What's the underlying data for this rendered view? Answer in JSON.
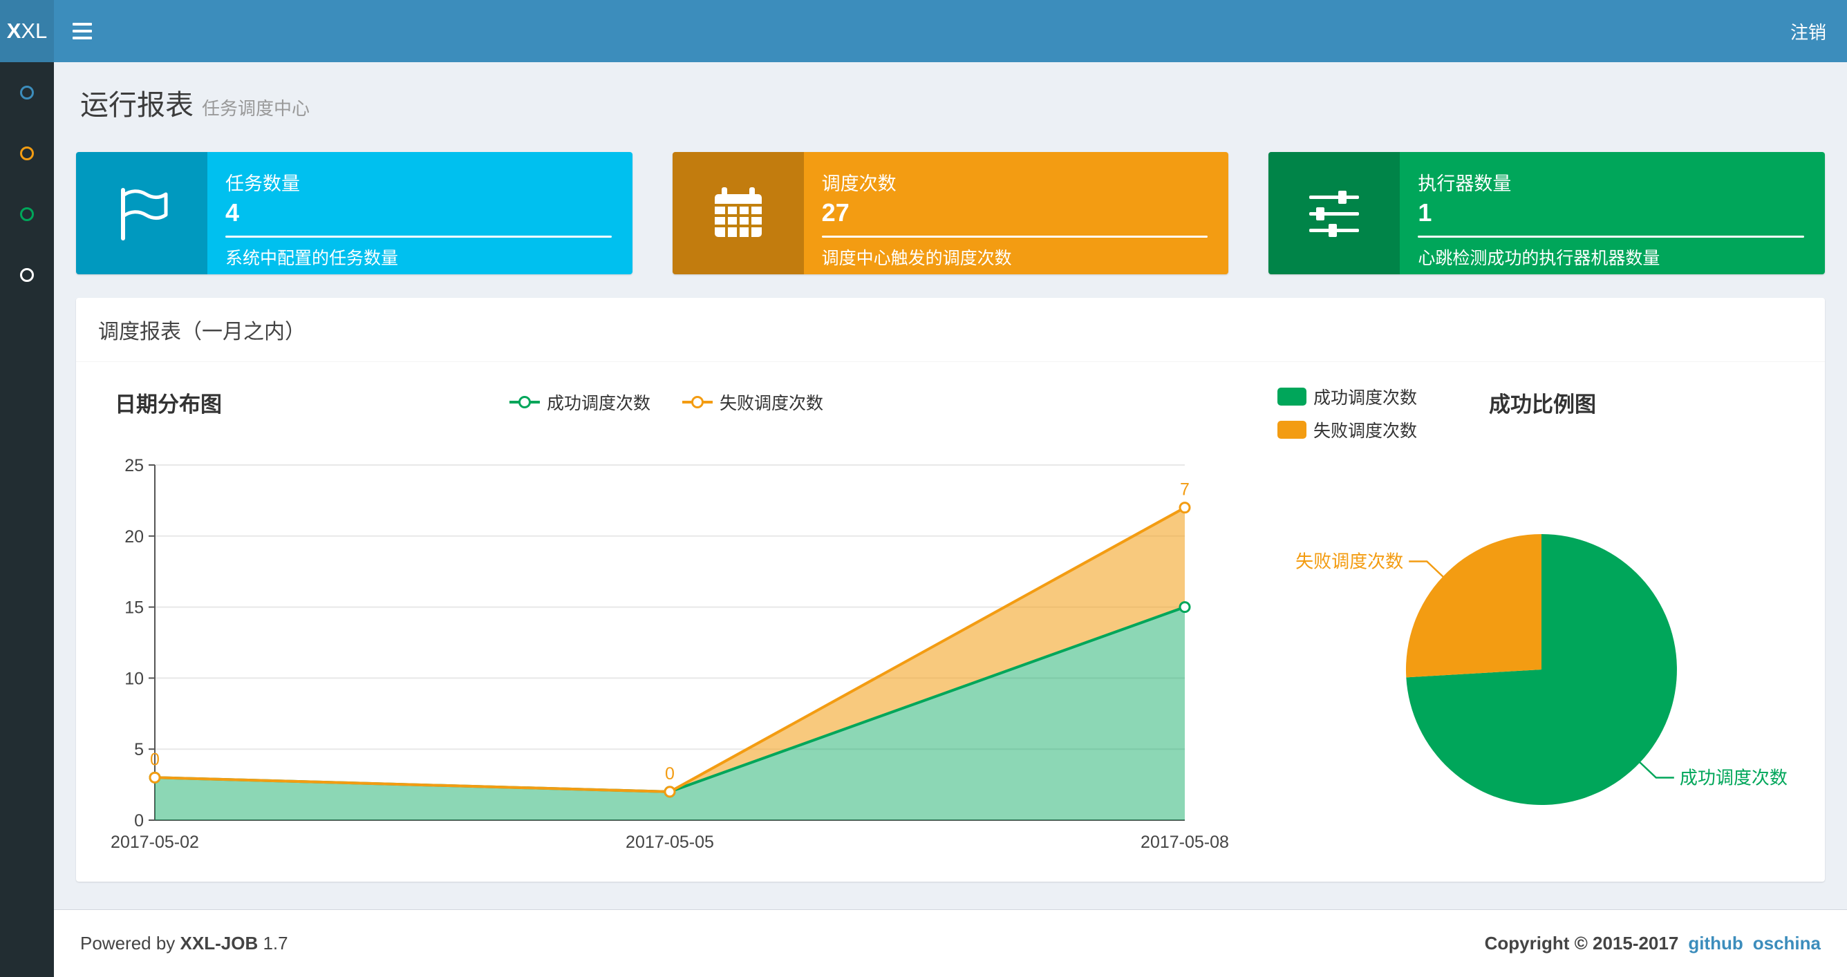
{
  "navbar": {
    "logo_bold": "X",
    "logo_rest": "XL",
    "logout_label": "注销",
    "accent_color": "#3c8dbc"
  },
  "sidebar": {
    "items": [
      {
        "icon": "circle-icon",
        "color": "#3c8dbc"
      },
      {
        "icon": "circle-icon",
        "color": "#f39c12"
      },
      {
        "icon": "circle-icon",
        "color": "#00a65a"
      },
      {
        "icon": "circle-icon",
        "color": "#ffffff"
      }
    ]
  },
  "header": {
    "title": "运行报表",
    "subtitle": "任务调度中心"
  },
  "stats": [
    {
      "title": "任务数量",
      "value": "4",
      "description": "系统中配置的任务数量",
      "bg": "#00c0ef",
      "icon": "flag-icon"
    },
    {
      "title": "调度次数",
      "value": "27",
      "description": "调度中心触发的调度次数",
      "bg": "#f39c12",
      "icon": "calendar-icon"
    },
    {
      "title": "执行器数量",
      "value": "1",
      "description": "心跳检测成功的执行器机器数量",
      "bg": "#00a65a",
      "icon": "sliders-icon"
    }
  ],
  "panel": {
    "title": "调度报表（一月之内）"
  },
  "chart_data": [
    {
      "type": "area",
      "title": "日期分布图",
      "x": [
        "2017-05-02",
        "2017-05-05",
        "2017-05-08"
      ],
      "series": [
        {
          "name": "成功调度次数",
          "values": [
            3,
            2,
            15
          ],
          "color": "#00A65A"
        },
        {
          "name": "失败调度次数",
          "values": [
            0,
            0,
            7
          ],
          "color": "#F39C12"
        }
      ],
      "stacked": true,
      "ylim": [
        0,
        25
      ],
      "yticks": [
        0,
        5,
        10,
        15,
        20,
        25
      ],
      "grid": true,
      "legend_position": "top-center",
      "point_labels": {
        "series": "失败调度次数",
        "values": [
          "0",
          "0",
          "7"
        ]
      }
    },
    {
      "type": "pie",
      "title": "成功比例图",
      "slices": [
        {
          "name": "成功调度次数",
          "value": 20,
          "color": "#00A65A"
        },
        {
          "name": "失败调度次数",
          "value": 7,
          "color": "#F39C12"
        }
      ],
      "legend_position": "top-left"
    }
  ],
  "footer": {
    "powered_prefix": "Powered by",
    "app_name": "XXL-JOB",
    "version": "1.7",
    "copyright": "Copyright © 2015-2017",
    "links": [
      {
        "label": "github"
      },
      {
        "label": "oschina"
      }
    ]
  }
}
